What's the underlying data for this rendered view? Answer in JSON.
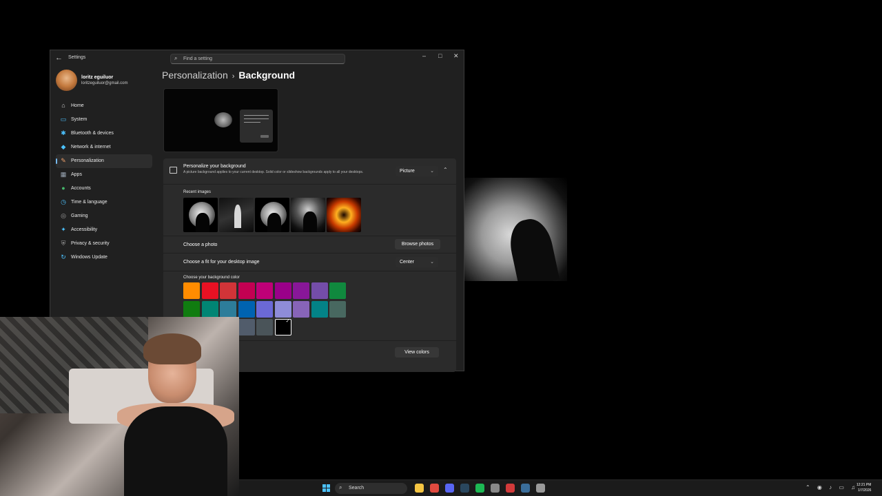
{
  "window": {
    "app_title": "Settings",
    "search_placeholder": "Find a setting",
    "controls": {
      "minimize": "–",
      "maximize": "□",
      "close": "✕"
    }
  },
  "user": {
    "name": "loritz eguiluor",
    "email": "loritzeguiluor@gmail.com"
  },
  "sidebar": {
    "items": [
      {
        "label": "Home",
        "icon": "home-icon",
        "glyph": "⌂",
        "color": "#d0d0d0",
        "active": false
      },
      {
        "label": "System",
        "icon": "system-icon",
        "glyph": "▭",
        "color": "#4cc2ff",
        "active": false
      },
      {
        "label": "Bluetooth & devices",
        "icon": "bluetooth-icon",
        "glyph": "✱",
        "color": "#4cc2ff",
        "active": false
      },
      {
        "label": "Network & internet",
        "icon": "network-icon",
        "glyph": "◆",
        "color": "#4cc2ff",
        "active": false
      },
      {
        "label": "Personalization",
        "icon": "brush-icon",
        "glyph": "✎",
        "color": "#f0a06a",
        "active": true
      },
      {
        "label": "Apps",
        "icon": "apps-icon",
        "glyph": "▦",
        "color": "#9aa6b4",
        "active": false
      },
      {
        "label": "Accounts",
        "icon": "accounts-icon",
        "glyph": "●",
        "color": "#46b86b",
        "active": false
      },
      {
        "label": "Time & language",
        "icon": "time-language-icon",
        "glyph": "◷",
        "color": "#4cc2ff",
        "active": false
      },
      {
        "label": "Gaming",
        "icon": "gaming-icon",
        "glyph": "◎",
        "color": "#a0a0a0",
        "active": false
      },
      {
        "label": "Accessibility",
        "icon": "accessibility-icon",
        "glyph": "✦",
        "color": "#4cc2ff",
        "active": false
      },
      {
        "label": "Privacy & security",
        "icon": "shield-icon",
        "glyph": "⛨",
        "color": "#a0a0a0",
        "active": false
      },
      {
        "label": "Windows Update",
        "icon": "update-icon",
        "glyph": "↻",
        "color": "#4cc2ff",
        "active": false
      }
    ]
  },
  "breadcrumb": {
    "parent": "Personalization",
    "separator": "›",
    "current": "Background"
  },
  "background_card": {
    "title": "Personalize your background",
    "description": "A picture background applies to your current desktop. Solid color or slideshow backgrounds apply to all your desktops.",
    "type_value": "Picture",
    "recent_images_label": "Recent images",
    "recent_images": [
      "moon-silhouette",
      "skater",
      "moon-silhouette-2",
      "dark-figure",
      "fire-ring"
    ],
    "choose_photo_label": "Choose a photo",
    "browse_button": "Browse photos",
    "fit_label": "Choose a fit for your desktop image",
    "fit_value": "Center",
    "color_label": "Choose your background color",
    "colors": [
      "#ff8c00",
      "#e81123",
      "#d13438",
      "#c30052",
      "#bf0077",
      "#9a0089",
      "#881798",
      "#744da9",
      "#10893e",
      "#107c10",
      "#018574",
      "#2d7d9a",
      "#0063b1",
      "#6b69d6",
      "#8e8cd8",
      "#8764b8",
      "#038387",
      "#486860",
      "#525e54",
      "#7e735f",
      "#4c4a48",
      "#515c6b",
      "#4a5459",
      "#000000"
    ],
    "selected_color": "#000000",
    "view_colors_button": "View colors"
  },
  "taskbar": {
    "search_label": "Search",
    "clock_time": "12:21 PM",
    "clock_date": "1/7/2026",
    "apps": [
      {
        "icon": "file-explorer-icon",
        "color": "#f5c542"
      },
      {
        "icon": "chrome-icon",
        "color": "#e04a3f"
      },
      {
        "icon": "discord-icon",
        "color": "#5865f2"
      },
      {
        "icon": "steam-icon",
        "color": "#2a475e"
      },
      {
        "icon": "spotify-icon",
        "color": "#1db954"
      },
      {
        "icon": "app-icon",
        "color": "#888888"
      },
      {
        "icon": "media-icon",
        "color": "#d23a3a"
      },
      {
        "icon": "steam-icon-2",
        "color": "#3a6d9a"
      },
      {
        "icon": "settings-icon",
        "color": "#9a9a9a"
      }
    ]
  }
}
